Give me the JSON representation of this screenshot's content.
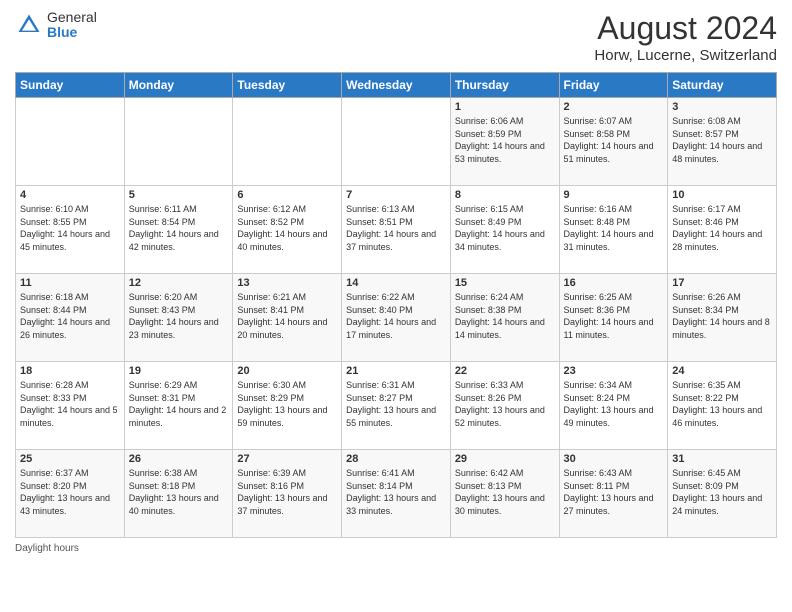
{
  "header": {
    "logo_general": "General",
    "logo_blue": "Blue",
    "month_year": "August 2024",
    "location": "Horw, Lucerne, Switzerland"
  },
  "days_header": [
    "Sunday",
    "Monday",
    "Tuesday",
    "Wednesday",
    "Thursday",
    "Friday",
    "Saturday"
  ],
  "footer": "Daylight hours",
  "weeks": [
    [
      {
        "day": "",
        "sunrise": "",
        "sunset": "",
        "daylight": ""
      },
      {
        "day": "",
        "sunrise": "",
        "sunset": "",
        "daylight": ""
      },
      {
        "day": "",
        "sunrise": "",
        "sunset": "",
        "daylight": ""
      },
      {
        "day": "",
        "sunrise": "",
        "sunset": "",
        "daylight": ""
      },
      {
        "day": "1",
        "sunrise": "Sunrise: 6:06 AM",
        "sunset": "Sunset: 8:59 PM",
        "daylight": "Daylight: 14 hours and 53 minutes."
      },
      {
        "day": "2",
        "sunrise": "Sunrise: 6:07 AM",
        "sunset": "Sunset: 8:58 PM",
        "daylight": "Daylight: 14 hours and 51 minutes."
      },
      {
        "day": "3",
        "sunrise": "Sunrise: 6:08 AM",
        "sunset": "Sunset: 8:57 PM",
        "daylight": "Daylight: 14 hours and 48 minutes."
      }
    ],
    [
      {
        "day": "4",
        "sunrise": "Sunrise: 6:10 AM",
        "sunset": "Sunset: 8:55 PM",
        "daylight": "Daylight: 14 hours and 45 minutes."
      },
      {
        "day": "5",
        "sunrise": "Sunrise: 6:11 AM",
        "sunset": "Sunset: 8:54 PM",
        "daylight": "Daylight: 14 hours and 42 minutes."
      },
      {
        "day": "6",
        "sunrise": "Sunrise: 6:12 AM",
        "sunset": "Sunset: 8:52 PM",
        "daylight": "Daylight: 14 hours and 40 minutes."
      },
      {
        "day": "7",
        "sunrise": "Sunrise: 6:13 AM",
        "sunset": "Sunset: 8:51 PM",
        "daylight": "Daylight: 14 hours and 37 minutes."
      },
      {
        "day": "8",
        "sunrise": "Sunrise: 6:15 AM",
        "sunset": "Sunset: 8:49 PM",
        "daylight": "Daylight: 14 hours and 34 minutes."
      },
      {
        "day": "9",
        "sunrise": "Sunrise: 6:16 AM",
        "sunset": "Sunset: 8:48 PM",
        "daylight": "Daylight: 14 hours and 31 minutes."
      },
      {
        "day": "10",
        "sunrise": "Sunrise: 6:17 AM",
        "sunset": "Sunset: 8:46 PM",
        "daylight": "Daylight: 14 hours and 28 minutes."
      }
    ],
    [
      {
        "day": "11",
        "sunrise": "Sunrise: 6:18 AM",
        "sunset": "Sunset: 8:44 PM",
        "daylight": "Daylight: 14 hours and 26 minutes."
      },
      {
        "day": "12",
        "sunrise": "Sunrise: 6:20 AM",
        "sunset": "Sunset: 8:43 PM",
        "daylight": "Daylight: 14 hours and 23 minutes."
      },
      {
        "day": "13",
        "sunrise": "Sunrise: 6:21 AM",
        "sunset": "Sunset: 8:41 PM",
        "daylight": "Daylight: 14 hours and 20 minutes."
      },
      {
        "day": "14",
        "sunrise": "Sunrise: 6:22 AM",
        "sunset": "Sunset: 8:40 PM",
        "daylight": "Daylight: 14 hours and 17 minutes."
      },
      {
        "day": "15",
        "sunrise": "Sunrise: 6:24 AM",
        "sunset": "Sunset: 8:38 PM",
        "daylight": "Daylight: 14 hours and 14 minutes."
      },
      {
        "day": "16",
        "sunrise": "Sunrise: 6:25 AM",
        "sunset": "Sunset: 8:36 PM",
        "daylight": "Daylight: 14 hours and 11 minutes."
      },
      {
        "day": "17",
        "sunrise": "Sunrise: 6:26 AM",
        "sunset": "Sunset: 8:34 PM",
        "daylight": "Daylight: 14 hours and 8 minutes."
      }
    ],
    [
      {
        "day": "18",
        "sunrise": "Sunrise: 6:28 AM",
        "sunset": "Sunset: 8:33 PM",
        "daylight": "Daylight: 14 hours and 5 minutes."
      },
      {
        "day": "19",
        "sunrise": "Sunrise: 6:29 AM",
        "sunset": "Sunset: 8:31 PM",
        "daylight": "Daylight: 14 hours and 2 minutes."
      },
      {
        "day": "20",
        "sunrise": "Sunrise: 6:30 AM",
        "sunset": "Sunset: 8:29 PM",
        "daylight": "Daylight: 13 hours and 59 minutes."
      },
      {
        "day": "21",
        "sunrise": "Sunrise: 6:31 AM",
        "sunset": "Sunset: 8:27 PM",
        "daylight": "Daylight: 13 hours and 55 minutes."
      },
      {
        "day": "22",
        "sunrise": "Sunrise: 6:33 AM",
        "sunset": "Sunset: 8:26 PM",
        "daylight": "Daylight: 13 hours and 52 minutes."
      },
      {
        "day": "23",
        "sunrise": "Sunrise: 6:34 AM",
        "sunset": "Sunset: 8:24 PM",
        "daylight": "Daylight: 13 hours and 49 minutes."
      },
      {
        "day": "24",
        "sunrise": "Sunrise: 6:35 AM",
        "sunset": "Sunset: 8:22 PM",
        "daylight": "Daylight: 13 hours and 46 minutes."
      }
    ],
    [
      {
        "day": "25",
        "sunrise": "Sunrise: 6:37 AM",
        "sunset": "Sunset: 8:20 PM",
        "daylight": "Daylight: 13 hours and 43 minutes."
      },
      {
        "day": "26",
        "sunrise": "Sunrise: 6:38 AM",
        "sunset": "Sunset: 8:18 PM",
        "daylight": "Daylight: 13 hours and 40 minutes."
      },
      {
        "day": "27",
        "sunrise": "Sunrise: 6:39 AM",
        "sunset": "Sunset: 8:16 PM",
        "daylight": "Daylight: 13 hours and 37 minutes."
      },
      {
        "day": "28",
        "sunrise": "Sunrise: 6:41 AM",
        "sunset": "Sunset: 8:14 PM",
        "daylight": "Daylight: 13 hours and 33 minutes."
      },
      {
        "day": "29",
        "sunrise": "Sunrise: 6:42 AM",
        "sunset": "Sunset: 8:13 PM",
        "daylight": "Daylight: 13 hours and 30 minutes."
      },
      {
        "day": "30",
        "sunrise": "Sunrise: 6:43 AM",
        "sunset": "Sunset: 8:11 PM",
        "daylight": "Daylight: 13 hours and 27 minutes."
      },
      {
        "day": "31",
        "sunrise": "Sunrise: 6:45 AM",
        "sunset": "Sunset: 8:09 PM",
        "daylight": "Daylight: 13 hours and 24 minutes."
      }
    ]
  ]
}
